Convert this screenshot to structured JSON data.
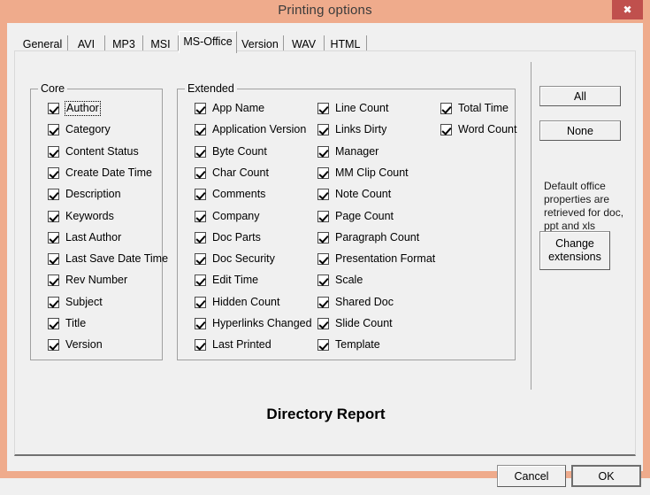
{
  "window": {
    "title": "Printing options",
    "close_label": "✖",
    "frame_color": "#efab8c",
    "close_button_color": "#c0504d",
    "client_color": "#f0f0f0"
  },
  "tabs": [
    {
      "label": "General",
      "selected": false
    },
    {
      "label": "AVI",
      "selected": false
    },
    {
      "label": "MP3",
      "selected": false
    },
    {
      "label": "MSI",
      "selected": false
    },
    {
      "label": "MS-Office",
      "selected": true
    },
    {
      "label": "Version",
      "selected": false
    },
    {
      "label": "WAV",
      "selected": false
    },
    {
      "label": "HTML",
      "selected": false
    }
  ],
  "core_group": {
    "title": "Core",
    "items": [
      {
        "label": "Author",
        "checked": true,
        "focused": true
      },
      {
        "label": "Category",
        "checked": true,
        "focused": false
      },
      {
        "label": "Content Status",
        "checked": true,
        "focused": false
      },
      {
        "label": "Create Date Time",
        "checked": true,
        "focused": false
      },
      {
        "label": "Description",
        "checked": true,
        "focused": false
      },
      {
        "label": "Keywords",
        "checked": true,
        "focused": false
      },
      {
        "label": "Last Author",
        "checked": true,
        "focused": false
      },
      {
        "label": "Last Save Date Time",
        "checked": true,
        "focused": false
      },
      {
        "label": "Rev Number",
        "checked": true,
        "focused": false
      },
      {
        "label": "Subject",
        "checked": true,
        "focused": false
      },
      {
        "label": "Title",
        "checked": true,
        "focused": false
      },
      {
        "label": "Version",
        "checked": true,
        "focused": false
      }
    ]
  },
  "extended_group": {
    "title": "Extended",
    "column1": [
      {
        "label": "App Name",
        "checked": true
      },
      {
        "label": "Application Version",
        "checked": true
      },
      {
        "label": "Byte Count",
        "checked": true
      },
      {
        "label": "Char Count",
        "checked": true
      },
      {
        "label": "Comments",
        "checked": true
      },
      {
        "label": "Company",
        "checked": true
      },
      {
        "label": "Doc Parts",
        "checked": true
      },
      {
        "label": "Doc Security",
        "checked": true
      },
      {
        "label": "Edit Time",
        "checked": true
      },
      {
        "label": "Hidden Count",
        "checked": true
      },
      {
        "label": "Hyperlinks Changed",
        "checked": true
      },
      {
        "label": "Last Printed",
        "checked": true
      }
    ],
    "column2": [
      {
        "label": "Line Count",
        "checked": true
      },
      {
        "label": "Links Dirty",
        "checked": true
      },
      {
        "label": "Manager",
        "checked": true
      },
      {
        "label": "MM Clip Count",
        "checked": true
      },
      {
        "label": "Note Count",
        "checked": true
      },
      {
        "label": "Page Count",
        "checked": true
      },
      {
        "label": "Paragraph Count",
        "checked": true
      },
      {
        "label": "Presentation Format",
        "checked": true
      },
      {
        "label": "Scale",
        "checked": true
      },
      {
        "label": "Shared Doc",
        "checked": true
      },
      {
        "label": "Slide Count",
        "checked": true
      },
      {
        "label": "Template",
        "checked": true
      }
    ],
    "column3": [
      {
        "label": "Total Time",
        "checked": true
      },
      {
        "label": "Word Count",
        "checked": true
      }
    ]
  },
  "side_panel": {
    "all_label": "All",
    "none_label": "None",
    "help_text": "Default office properties are retrieved for doc, ppt and xls extensions",
    "change_extensions_line1": "Change",
    "change_extensions_line2": "extensions"
  },
  "footer": {
    "heading": "Directory Report",
    "cancel_label": "Cancel",
    "ok_label": "OK"
  }
}
